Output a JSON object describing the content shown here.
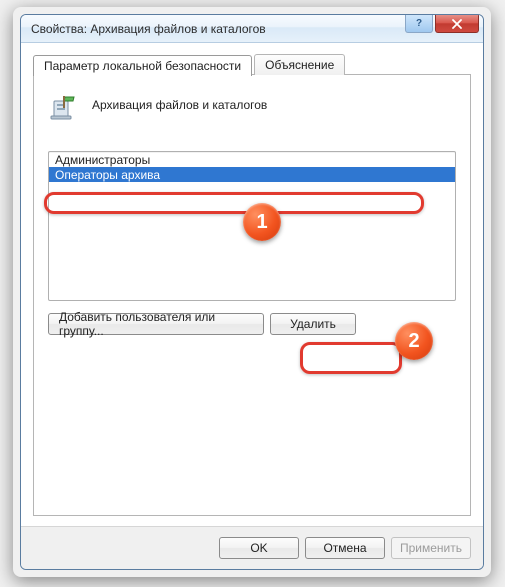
{
  "window": {
    "title": "Свойства: Архивация файлов и каталогов"
  },
  "tabs": {
    "active": "Параметр локальной безопасности",
    "inactive": "Объяснение"
  },
  "panel": {
    "header_title": "Архивация файлов и каталогов"
  },
  "list": {
    "items": [
      {
        "label": "Администраторы",
        "selected": false
      },
      {
        "label": "Операторы архива",
        "selected": true
      }
    ]
  },
  "buttons": {
    "add": "Добавить пользователя или группу...",
    "delete": "Удалить",
    "ok": "OK",
    "cancel": "Отмена",
    "apply": "Применить"
  },
  "annotations": {
    "badge1": "1",
    "badge2": "2"
  }
}
